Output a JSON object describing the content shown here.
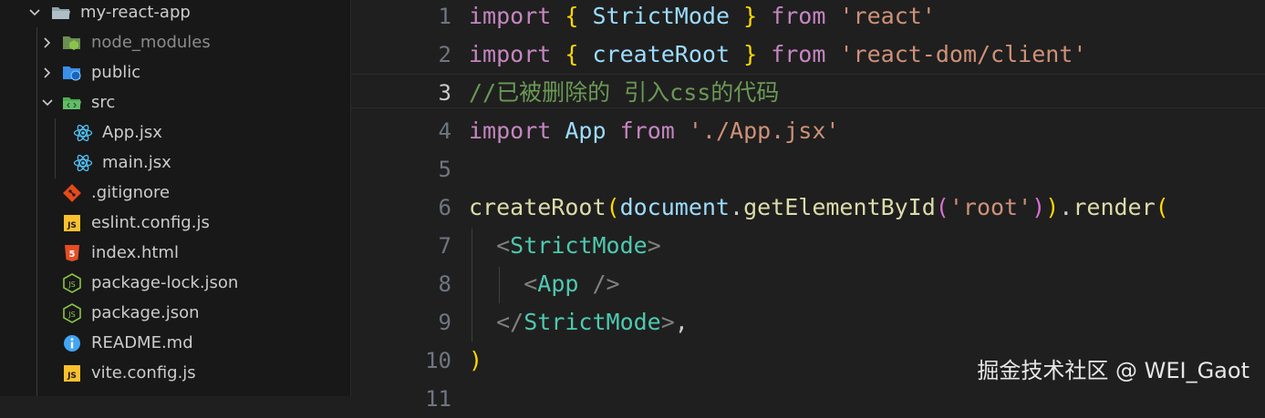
{
  "explorer": {
    "root": {
      "label": "my-react-app",
      "icon": "folder-open-icon"
    },
    "items": [
      {
        "label": "node_modules",
        "icon": "folder-node-icon"
      },
      {
        "label": "public",
        "icon": "folder-public-icon"
      },
      {
        "label": "src",
        "icon": "folder-src-open-icon"
      },
      {
        "label": "App.jsx",
        "icon": "react-icon"
      },
      {
        "label": "main.jsx",
        "icon": "react-icon"
      },
      {
        "label": ".gitignore",
        "icon": "git-icon"
      },
      {
        "label": "eslint.config.js",
        "icon": "js-icon"
      },
      {
        "label": "index.html",
        "icon": "html5-icon"
      },
      {
        "label": "package-lock.json",
        "icon": "nodejs-icon"
      },
      {
        "label": "package.json",
        "icon": "nodejs-icon"
      },
      {
        "label": "README.md",
        "icon": "info-icon"
      },
      {
        "label": "vite.config.js",
        "icon": "js-icon"
      }
    ]
  },
  "editor": {
    "line_numbers": [
      "1",
      "2",
      "3",
      "4",
      "5",
      "6",
      "7",
      "8",
      "9",
      "10",
      "11"
    ],
    "active_line": "3",
    "lines": {
      "l1": {
        "kw_import": "import",
        "b_open": "{",
        "name": "StrictMode",
        "b_close": "}",
        "kw_from": "from",
        "str": "'react'"
      },
      "l2": {
        "kw_import": "import",
        "b_open": "{",
        "name": "createRoot",
        "b_close": "}",
        "kw_from": "from",
        "str": "'react-dom/client'"
      },
      "l3": {
        "comment": "//已被删除的 引入css的代码"
      },
      "l4": {
        "kw_import": "import",
        "name": "App",
        "kw_from": "from",
        "str": "'./App.jsx'"
      },
      "l6": {
        "fn": "createRoot",
        "p1": "(",
        "obj": "document",
        "dot1": ".",
        "method": "getElementById",
        "p2": "(",
        "str": "'root'",
        "p2c": ")",
        "p1c": ")",
        "dot2": ".",
        "render": "render",
        "p3": "("
      },
      "l7": {
        "lt": "<",
        "tag": "StrictMode",
        "gt": ">"
      },
      "l8": {
        "lt": "<",
        "tag": "App",
        "end": " />"
      },
      "l9": {
        "lt": "</",
        "tag": "StrictMode",
        "gt": ">",
        "comma": ","
      },
      "l10": {
        "p3c": ")"
      }
    }
  },
  "watermark": "掘金技术社区 @ WEI_Gaot",
  "colors": {
    "keyword": "#c586c0",
    "string": "#ce9178",
    "variable": "#9cdcfe",
    "function": "#dcdcaa",
    "comment": "#6a9955",
    "tag": "#4ec9b0",
    "bracket_gold": "#ffd700",
    "bracket_violet": "#da70d6",
    "bracket_blue": "#179fff"
  }
}
